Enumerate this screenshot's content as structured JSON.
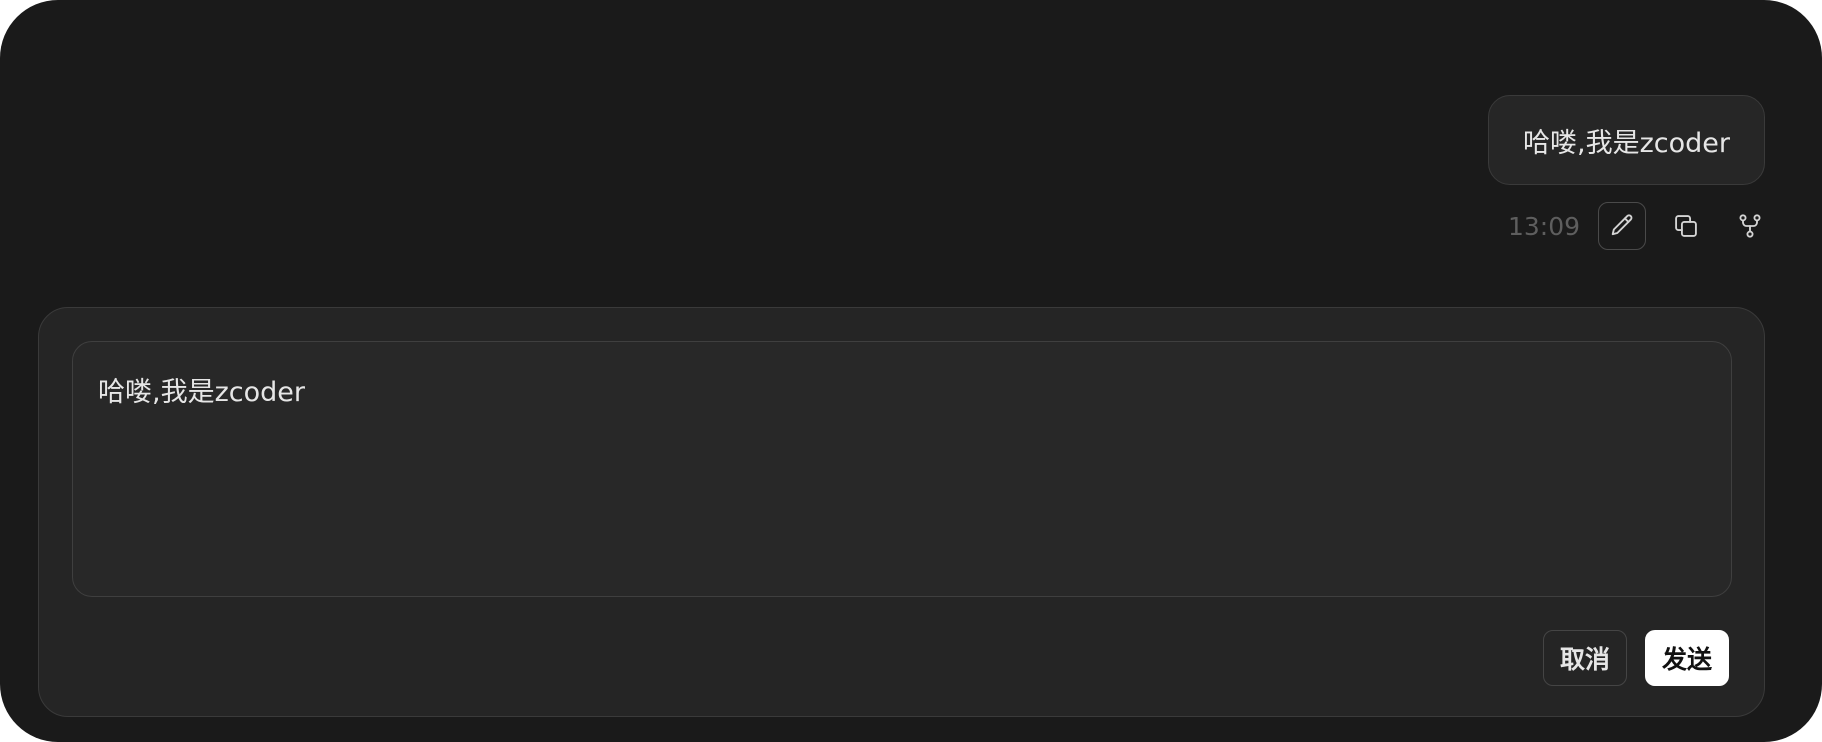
{
  "message": {
    "text": "哈喽,我是zcoder",
    "time": "13:09",
    "actions": [
      {
        "icon": "pencil-icon",
        "label": ""
      },
      {
        "icon": "copy-icon",
        "label": ""
      },
      {
        "icon": "branch-icon",
        "label": ""
      }
    ]
  },
  "editor": {
    "value": "哈喽,我是zcoder",
    "cancel_label": "取消",
    "send_label": "发送"
  },
  "colors": {
    "background": "#1a1a1a",
    "panel": "#252525",
    "border": "#3a3a3a",
    "text": "#e6e6e6",
    "muted": "#5e5e5e",
    "primary_button": "#ffffff"
  }
}
